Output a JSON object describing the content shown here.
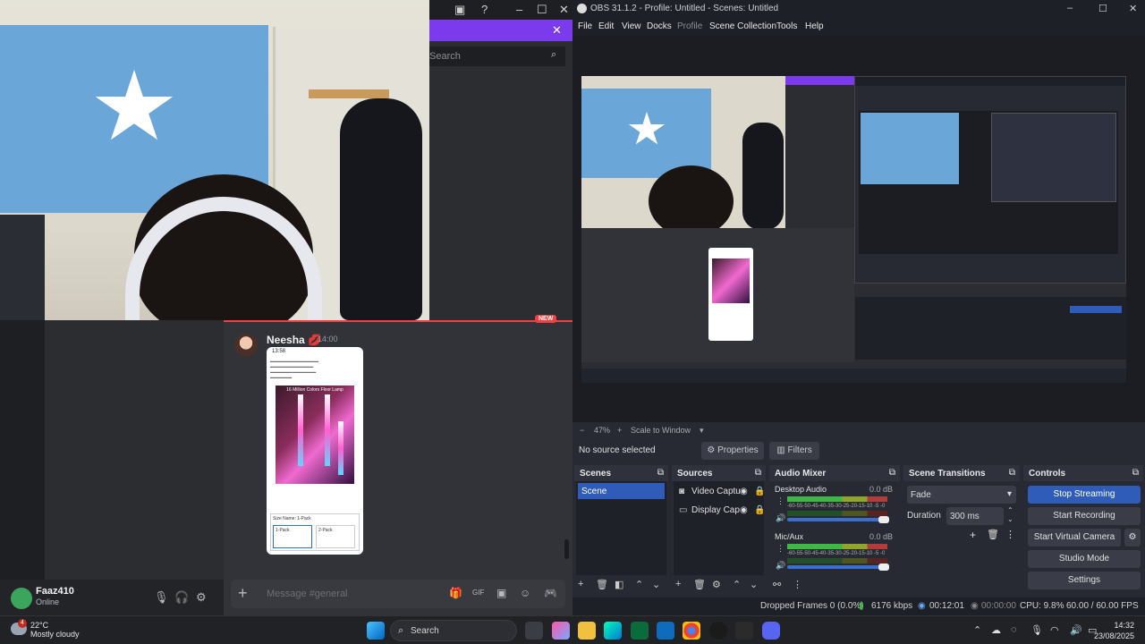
{
  "discord": {
    "search_placeholder": "Search",
    "new_badge": "NEW",
    "message": {
      "author": "Neesha",
      "time": "14:00",
      "emoji": "💋"
    },
    "phone": {
      "time": "13:58",
      "title": "16 Million Colors Floor Lamp",
      "size_label": "Size Name: 1-Pack",
      "option1": "1-Pack",
      "option2": "2-Pack"
    },
    "user": {
      "name": "Faaz410",
      "status": "Online"
    },
    "input_placeholder": "Message #general",
    "icons": {
      "mic": "🎙",
      "headset": "🎧",
      "settings": "⚙",
      "plus": "+",
      "gift": "🎁",
      "gif": "GIF",
      "sticker": "▣",
      "emoji": "☺",
      "apps": "🎮"
    }
  },
  "obs": {
    "title": "OBS 31.1.2 - Profile: Untitled - Scenes: Untitled",
    "menu": [
      "File",
      "Edit",
      "View",
      "Docks",
      "Profile",
      "Scene Collection",
      "Tools",
      "Help"
    ],
    "zoom": {
      "minus": "−",
      "value": "47%",
      "plus": "+",
      "mode": "Scale to Window"
    },
    "no_source": "No source selected",
    "properties_btn": "Properties",
    "filters_btn": "Filters",
    "docks": {
      "scenes": {
        "title": "Scenes",
        "items": [
          "Scene"
        ]
      },
      "sources": {
        "title": "Sources",
        "items": [
          "Video Captu",
          "Display Cap"
        ]
      },
      "mixer": {
        "title": "Audio Mixer",
        "channels": [
          {
            "name": "Desktop Audio",
            "db": "0.0 dB",
            "scale": "-60-55-50-45-40-35-30-25-20-15-10 -5 -0"
          },
          {
            "name": "Mic/Aux",
            "db": "0.0 dB",
            "scale": "-60-55-50-45-40-35-30-25-20-15-10 -5 -0"
          }
        ]
      },
      "transitions": {
        "title": "Scene Transitions",
        "type": "Fade",
        "duration_label": "Duration",
        "duration": "300 ms"
      },
      "controls": {
        "title": "Controls",
        "buttons": [
          "Stop Streaming",
          "Start Recording",
          "Start Virtual Camera",
          "Studio Mode",
          "Settings"
        ]
      }
    },
    "status": {
      "dropped": "Dropped Frames 0 (0.0%)",
      "bitrate": "6176 kbps",
      "stream_time": "00:12:01",
      "rec_time": "00:00:00",
      "cpu": "CPU: 9.8%",
      "fps": "60.00 / 60.00 FPS"
    }
  },
  "taskbar": {
    "weather_temp": "22°C",
    "weather_desc": "Mostly cloudy",
    "weather_badge": "4",
    "search_label": "Search",
    "time": "14:32",
    "date": "23/08/2025"
  },
  "colors": {
    "discord_purple": "#7c3aed",
    "obs_blue": "#2e5cb8",
    "new_red": "#f23f43",
    "discord_green": "#3ba55d"
  }
}
